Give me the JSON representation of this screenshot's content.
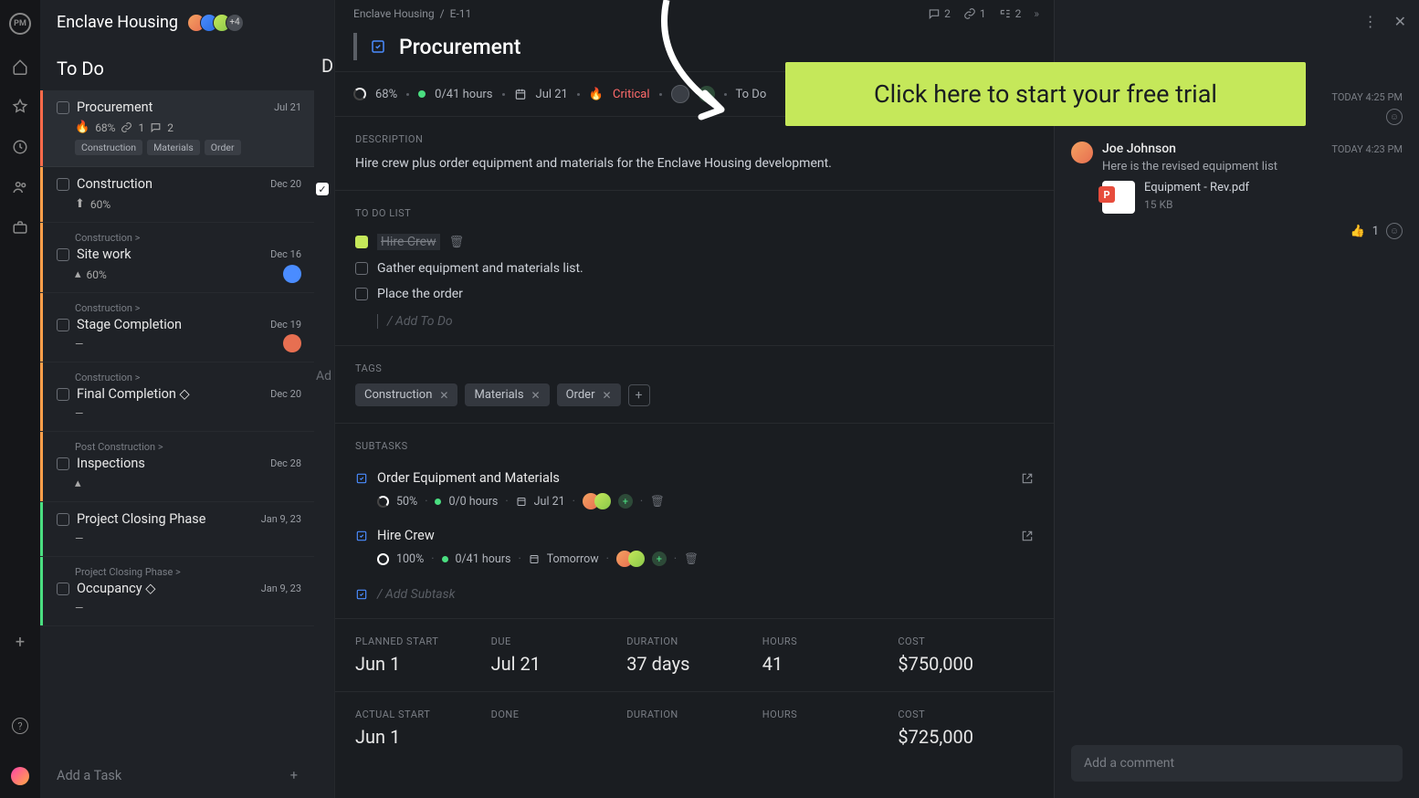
{
  "project": {
    "name": "Enclave Housing",
    "avatars_more": "+4"
  },
  "column_title": "To Do",
  "tasks": [
    {
      "name": "Procurement",
      "date": "Jul 21",
      "pct": "68%",
      "links": "1",
      "comments": "2",
      "tags": [
        "Construction",
        "Materials",
        "Order"
      ],
      "edge": "#ff6b4a",
      "active": true,
      "priority_icon": "🔥"
    },
    {
      "name": "Construction",
      "date": "Dec 20",
      "pct": "60%",
      "edge": "#ff9f4a",
      "priority_icon": "⬆"
    },
    {
      "breadcrumb": "Construction >",
      "name": "Site work",
      "date": "Dec 16",
      "pct": "60%",
      "edge": "#ff9f4a",
      "priority_icon": "▴",
      "avatar": "#4a8cff"
    },
    {
      "breadcrumb": "Construction >",
      "name": "Stage Completion",
      "date": "Dec 19",
      "pct": "—",
      "edge": "#ff9f4a",
      "avatar": "#e76f51"
    },
    {
      "breadcrumb": "Construction >",
      "name": "Final Completion ◇",
      "date": "Dec 20",
      "pct": "—",
      "edge": "#ff9f4a"
    },
    {
      "breadcrumb": "Post Construction >",
      "name": "Inspections",
      "date": "Dec 28",
      "pct": "",
      "edge": "#ff9f4a",
      "priority_icon": "▴"
    },
    {
      "name": "Project Closing Phase",
      "date": "Jan 9, 23",
      "pct": "—",
      "edge": "#4ade80"
    },
    {
      "breadcrumb": "Project Closing Phase >",
      "name": "Occupancy ◇",
      "date": "Jan 9, 23",
      "pct": "—",
      "edge": "#4ade80"
    }
  ],
  "add_task_label": "Add a Task",
  "detail": {
    "breadcrumb": {
      "project": "Enclave Housing",
      "id": "E-11"
    },
    "stats": {
      "comments": "2",
      "links": "1",
      "subtasks": "2"
    },
    "title": "Procurement",
    "meta": {
      "pct": "68%",
      "hours": "0/41 hours",
      "due": "Jul 21",
      "priority": "Critical",
      "status": "To Do"
    },
    "description_label": "Description",
    "description": "Hire crew plus order equipment and materials for the Enclave Housing development.",
    "todo_label": "To Do List",
    "todos": [
      {
        "label": "Hire Crew",
        "done": true
      },
      {
        "label": "Gather equipment and materials list.",
        "done": false
      },
      {
        "label": "Place the order",
        "done": false
      }
    ],
    "add_todo": "/ Add To Do",
    "tags_label": "Tags",
    "tags": [
      "Construction",
      "Materials",
      "Order"
    ],
    "subtasks_label": "Subtasks",
    "subtasks": [
      {
        "name": "Order Equipment and Materials",
        "pct": "50%",
        "hours": "0/0 hours",
        "due": "Jul 21"
      },
      {
        "name": "Hire Crew",
        "pct": "100%",
        "hours": "0/41 hours",
        "due": "Tomorrow"
      }
    ],
    "add_subtask": "/ Add Subtask",
    "planned": {
      "start_lbl": "Planned Start",
      "start": "Jun 1",
      "due_lbl": "Due",
      "due": "Jul 21",
      "duration_lbl": "Duration",
      "duration": "37 days",
      "hours_lbl": "Hours",
      "hours": "41",
      "cost_lbl": "Cost",
      "cost": "$750,000"
    },
    "actual": {
      "start_lbl": "Actual Start",
      "start": "Jun 1",
      "done_lbl": "Done",
      "done": "",
      "duration_lbl": "Duration",
      "duration": "",
      "hours_lbl": "Hours",
      "hours": "",
      "cost_lbl": "Cost",
      "cost": "$725,000"
    }
  },
  "comments": [
    {
      "author": "",
      "time": "TODAY 4:25 PM",
      "text": "",
      "empty_header": true
    },
    {
      "author": "Joe Johnson",
      "time": "TODAY 4:23 PM",
      "text": "Here is the revised equipment list",
      "attachment": {
        "name": "Equipment - Rev.pdf",
        "size": "15 KB"
      },
      "reaction_count": "1"
    }
  ],
  "comment_placeholder": "Add a comment",
  "cta": "Click here to start your free trial",
  "ghost": {
    "letter_D": "D",
    "add_placeholder": "Ad"
  }
}
